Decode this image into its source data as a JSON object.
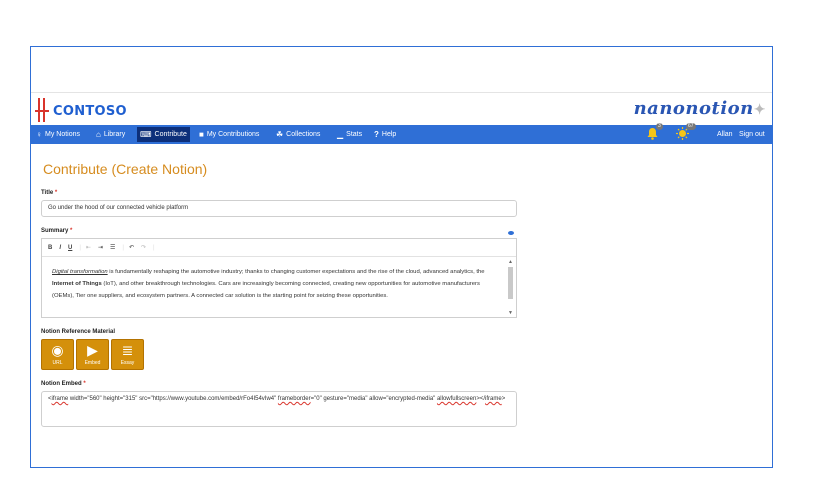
{
  "header": {
    "logo_text": "CONTOSO",
    "brand": "nanonotion",
    "brand_mark": "✦"
  },
  "nav": {
    "items": [
      {
        "label": "My Notions",
        "icon": "lightbulb-icon",
        "glyph": "♀"
      },
      {
        "label": "Library",
        "icon": "library-icon",
        "glyph": "⌂"
      },
      {
        "label": "Contribute",
        "icon": "keyboard-icon",
        "glyph": "⌨"
      },
      {
        "label": "My Contributions",
        "icon": "briefcase-icon",
        "glyph": "■"
      },
      {
        "label": "Collections",
        "icon": "collections-icon",
        "glyph": "☘"
      },
      {
        "label": "Stats",
        "icon": "chart-icon",
        "glyph": "▁"
      },
      {
        "label": "Help",
        "icon": "help-icon",
        "glyph": "?"
      }
    ],
    "notifications_count": "3",
    "points_count": "67",
    "user": "Allan",
    "signout": "Sign out"
  },
  "page": {
    "title": "Contribute (Create Notion)"
  },
  "form": {
    "title_label": "Title",
    "title_value": "Go under the hood of our connected vehicle platform",
    "required_mark": "*",
    "summary_label": "Summary",
    "toolbar": {
      "bold": "B",
      "italic": "I",
      "underline": "U",
      "indent_less": "⇤",
      "indent_more": "⇥",
      "list": "☰",
      "undo": "↶",
      "redo": "↷"
    },
    "summary": {
      "part1": "Digital transformation",
      "part2": " is fundamentally reshaping the automotive industry; thanks to changing customer expectations and the rise of the cloud, advanced analytics, the ",
      "part3": "Internet of Things",
      "part4": " (IoT), and other breakthrough technologies. Cars are increasingly becoming connected, creating new opportunities for automotive manufacturers (OEMs), Tier one suppliers, and ecosystem partners. A connected car solution is the starting point for seizing these opportunities."
    },
    "reference_label": "Notion Reference Material",
    "reference_buttons": [
      {
        "label": "URL",
        "glyph": "◉"
      },
      {
        "label": "Embed",
        "glyph": "▶"
      },
      {
        "label": "Essay",
        "glyph": "≣"
      }
    ],
    "embed_label": "Notion Embed",
    "embed": {
      "a": "<",
      "b": "iframe",
      "c": " width=\"560\" height=\"315\" src=\"https://www.youtube.com/embed/rFo4I54vIw4\" ",
      "d": "frameborder",
      "e": "=\"0\" gesture=\"media\" allow=\"encrypted-media\" ",
      "f": "allowfullscreen",
      "g": "></",
      "h": "iframe",
      "i": ">"
    }
  },
  "colors": {
    "accent": "#2f6fd6",
    "nav_active": "#0d2f7a",
    "title": "#d68c1f",
    "reference_button": "#d4900b"
  }
}
